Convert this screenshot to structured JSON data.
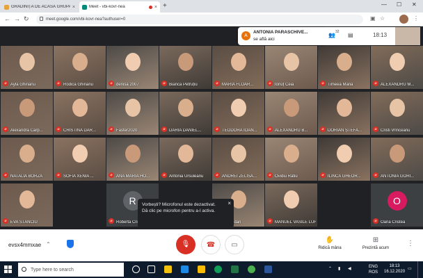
{
  "browser": {
    "tabs": [
      {
        "title": "GRĂDINIȚA DE ACASĂ GRUPA M...",
        "favicon_color": "#e8a33d"
      },
      {
        "title": "Meet - vbi-kovr-nea",
        "favicon_color": "#00897b",
        "active": true
      }
    ],
    "new_tab": "+",
    "url": "meet.google.com/vbi-kovr-nea?authuser=0"
  },
  "notification": {
    "avatar_letter": "A",
    "name": "ANTONIA PARASCHIVE...",
    "status": "se află aici"
  },
  "top_controls": {
    "participants_count": "32",
    "time": "18:13"
  },
  "participants": [
    {
      "name": "Ayla Ghirianu"
    },
    {
      "name": "Rodica Ghirianu"
    },
    {
      "name": "denisa 2007"
    },
    {
      "name": "Bianca Petruțiu"
    },
    {
      "name": "MARIA FLOAR..."
    },
    {
      "name": "Ionuț Ceia"
    },
    {
      "name": "Timeea Maria"
    },
    {
      "name": "ALEXANDRU M..."
    },
    {
      "name": "Alexandra Carp..."
    },
    {
      "name": "CRISTINA DAR..."
    },
    {
      "name": "Faster2020"
    },
    {
      "name": "DARIA DANIEL..."
    },
    {
      "name": "TEODORA IOAN..."
    },
    {
      "name": "ALEXANDRU B..."
    },
    {
      "name": "DORIAN ȘTEFA..."
    },
    {
      "name": "Cristi Vrînceanu"
    },
    {
      "name": "NATALIA BORZA"
    },
    {
      "name": "SOFIA XENIA ..."
    },
    {
      "name": "ANA MARIA HO..."
    },
    {
      "name": "Antonia Ursuleanu"
    },
    {
      "name": "ANDREI ZELISA..."
    },
    {
      "name": "Ovidiu Ratiu"
    },
    {
      "name": "ILINCA GHEOR..."
    },
    {
      "name": "ANTONIA GORI..."
    },
    {
      "name": "EVA STANCIU"
    },
    {
      "name": "Roberta Crisan",
      "letter": "R"
    },
    {
      "name": "... Bogdan"
    },
    {
      "name": "MANUEL VASILE LUHA"
    },
    {
      "name": "Oana Cristea",
      "letter": "O"
    }
  ],
  "mic_tooltip": {
    "line1": "Vorbești? Microfonul este dezactivat.",
    "line2": "Dă clic pe microfon pentru a-l activa.",
    "close": "×"
  },
  "bottom_bar": {
    "meeting_code": "evsx4mmxae",
    "raise_hand_label": "Ridică mâna",
    "present_label": "Prezintă acum"
  },
  "taskbar": {
    "search_placeholder": "Type here to search",
    "lang_top": "ENG",
    "lang_bottom": "ROS",
    "time": "18:13",
    "date": "16.12.2020"
  },
  "colors": {
    "mute_red": "#d93025",
    "meet_dark": "#202124",
    "taskbar": "#0e1b2c",
    "roberta_avatar": "#5f6368",
    "oana_avatar": "#d81b60"
  }
}
